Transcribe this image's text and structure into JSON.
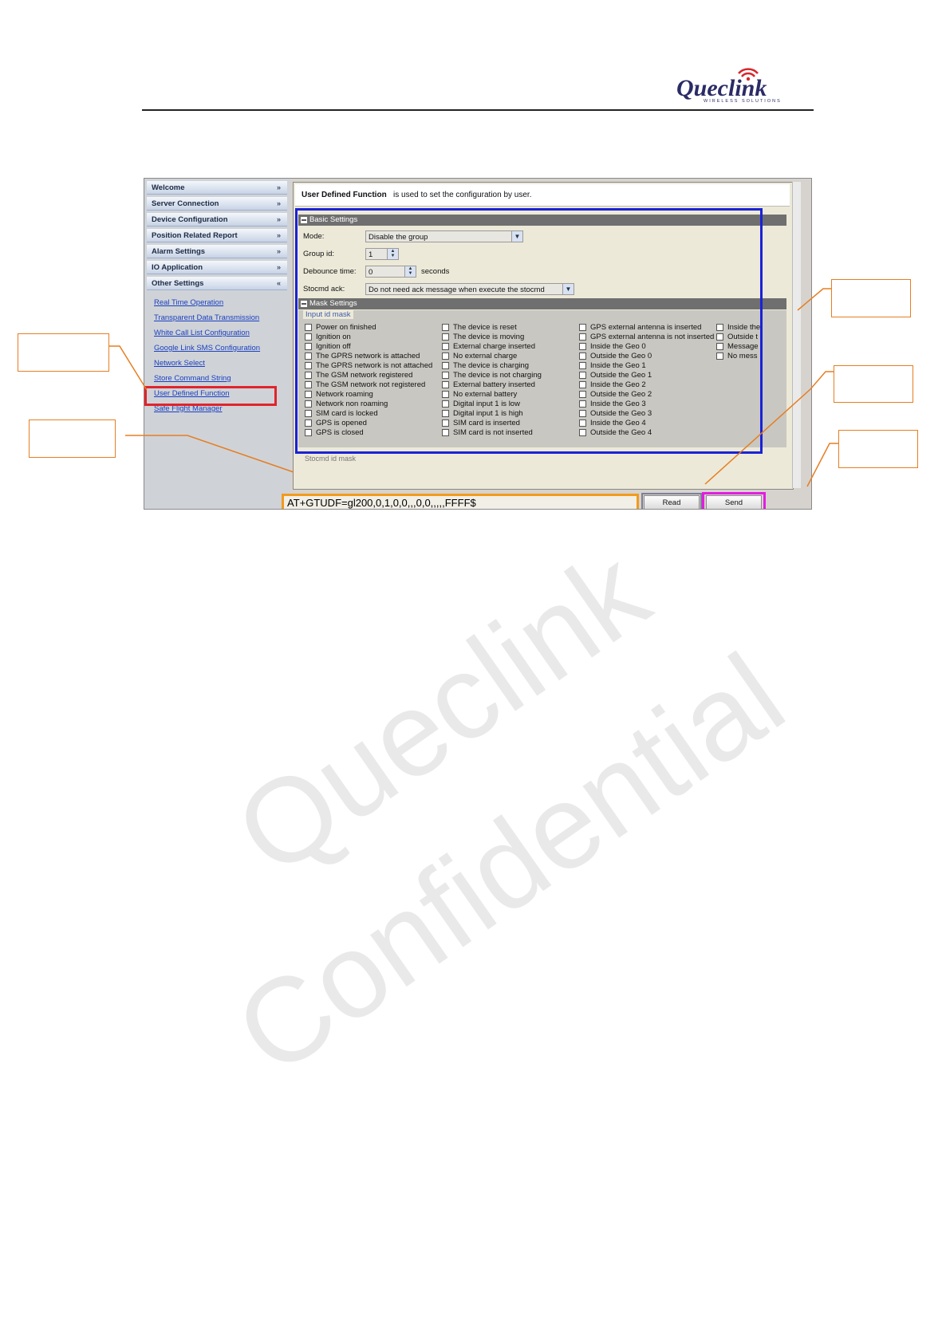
{
  "header": {
    "logo_text": "Queclink",
    "logo_tagline": "WIRELESS SOLUTIONS",
    "brand_color": "#2b2b66",
    "signal_color": "#d7262b"
  },
  "watermark": {
    "line1": "Queclink",
    "line2": "Confidential"
  },
  "sidebar": {
    "sections": [
      {
        "label": "Welcome",
        "chevron": "»"
      },
      {
        "label": "Server Connection",
        "chevron": "»"
      },
      {
        "label": "Device Configuration",
        "chevron": "»"
      },
      {
        "label": "Position Related Report",
        "chevron": "»"
      },
      {
        "label": "Alarm Settings",
        "chevron": "»"
      },
      {
        "label": "IO Application",
        "chevron": "»"
      },
      {
        "label": "Other Settings",
        "chevron": "«"
      }
    ],
    "links": [
      "Real Time Operation",
      "Transparent Data Transmission",
      "White Call List Configuration",
      "Google Link SMS Configuration",
      "Network Select",
      "Store Command String",
      "User Defined Function",
      "Safe Flight Manager"
    ],
    "selected_link": "User Defined Function"
  },
  "intro": {
    "title": "User Defined Function",
    "text": "is used to set the configuration by user."
  },
  "basic_settings": {
    "title": "Basic Settings",
    "mode_label": "Mode:",
    "mode_value": "Disable the group",
    "group_label": "Group id:",
    "group_value": "1",
    "debounce_label": "Debounce time:",
    "debounce_value": "0",
    "debounce_unit": "seconds",
    "stocmd_label": "Stocmd ack:",
    "stocmd_value": "Do not need ack message when execute the stocmd"
  },
  "mask_settings": {
    "title": "Mask Settings",
    "input_mask_caption": "Input id mask",
    "col1": [
      "Power on finished",
      "Ignition on",
      "Ignition off",
      "The GPRS network is attached",
      "The GPRS network is not attached",
      "The GSM network registered",
      "The GSM network not registered",
      "Network roaming",
      "Network non roaming",
      "SIM card is locked",
      "GPS is opened",
      "GPS is closed"
    ],
    "col2": [
      "The device is reset",
      "The device is moving",
      "External charge inserted",
      "No external charge",
      "The device is charging",
      "The device is not charging",
      "External battery inserted",
      "No external battery",
      "Digital input 1 is low",
      "Digital input 1 is high",
      "SIM card is inserted",
      "SIM card is not inserted"
    ],
    "col3": [
      "GPS external antenna is inserted",
      "GPS external antenna is not inserted",
      "Inside the Geo 0",
      "Outside the Geo 0",
      "Inside the Geo 1",
      "Outside the Geo 1",
      "Inside the Geo 2",
      "Outside the Geo 2",
      "Inside the Geo 3",
      "Outside the Geo 3",
      "Inside the Geo 4",
      "Outside the Geo 4"
    ],
    "col4": [
      "Inside the",
      "Outside t",
      "Message",
      "No mess"
    ],
    "stocmd_mask_caption": "Stocmd id mask"
  },
  "command": {
    "value": "AT+GTUDF=gl200,0,1,0,0,,,0,0,,,,,FFFF$"
  },
  "buttons": {
    "read": "Read",
    "send": "Send"
  },
  "highlight_colors": {
    "selection": "#e0242b",
    "settings": "#1a22d6",
    "command": "#f29a1b",
    "read": "#7d7d9a",
    "send": "#e21de0",
    "callout": "#e67e22"
  }
}
